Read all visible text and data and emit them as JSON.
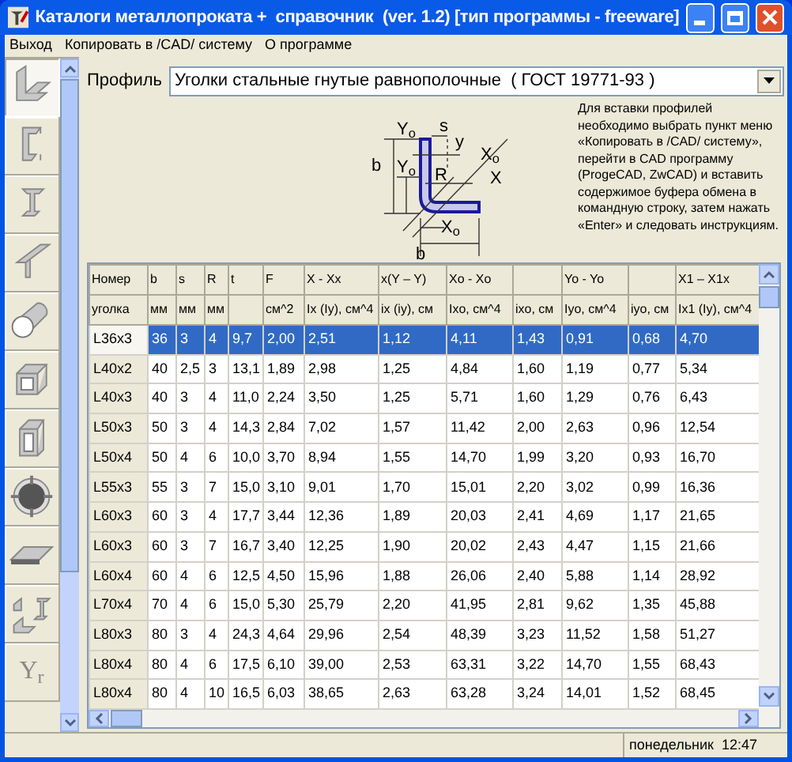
{
  "window": {
    "title": "Каталоги металлопроката +  справочник  (ver. 1.2) [тип программы - freeware]"
  },
  "menu": [
    "Выход",
    "Копировать в /CAD/ систему",
    "О программе"
  ],
  "sidebar": {
    "items": [
      {
        "selected": true
      },
      {
        "selected": false
      },
      {
        "selected": false
      },
      {
        "selected": false
      },
      {
        "selected": false
      },
      {
        "selected": false
      },
      {
        "selected": false
      },
      {
        "selected": false
      },
      {
        "selected": false
      },
      {
        "selected": false
      },
      {
        "selected": false,
        "label": "Y$_{r}$"
      }
    ]
  },
  "profile": {
    "label": "Профиль",
    "value": "Уголки стальные гнутые равнополочные  ( ГОСТ 19771-93 )"
  },
  "diagram": {
    "labels": [
      "Y$_{o}$",
      "s",
      "y",
      "X$_{o}$",
      "b",
      "Y$_{o}$",
      "R",
      "X",
      "X$_{o}$",
      "b"
    ]
  },
  "instructions": "Для вставки профилей необходимо выбрать пункт меню «Копировать в /CAD/ систему», перейти в CAD программу (ProgeCAD, ZwCAD) и вставить содержимое буфера обмена в командную строку,  затем нажать «Enter» и следовать инструкциям.",
  "table": {
    "columns": [
      {
        "top": "Номер",
        "bottom": "уголка"
      },
      {
        "top": "b",
        "bottom": "мм"
      },
      {
        "top": "s",
        "bottom": "мм"
      },
      {
        "top": "R",
        "bottom": "мм"
      },
      {
        "top": "t"
      },
      {
        "top": "F",
        "bottom": "см^2"
      },
      {
        "top": "X - Xx",
        "bottom": "Ix (Iy), см^4"
      },
      {
        "top": "x(Y – Y)",
        "bottom": "ix (iy), см"
      },
      {
        "top": "Xo - Xo",
        "bottom": "Ixo, см^4"
      },
      {
        "bottom": "ixo, см"
      },
      {
        "top": "Yo - Yo",
        "bottom": "Iyo, см^4"
      },
      {
        "bottom": "iyo, см"
      },
      {
        "top": "X1 – X1x",
        "bottom": "Ix1 (Iy), см^4"
      }
    ],
    "rows": [
      {
        "selected": true,
        "cells": [
          "L36x3",
          "36",
          "3",
          "4",
          "9,7",
          "2,00",
          "2,51",
          "1,12",
          "4,11",
          "1,43",
          "0,91",
          "0,68",
          "4,70"
        ]
      },
      {
        "selected": false,
        "cells": [
          "L40x2",
          "40",
          "2,5",
          "3",
          "13,1",
          "1,89",
          "2,98",
          "1,25",
          "4,84",
          "1,60",
          "1,19",
          "0,77",
          "5,34"
        ]
      },
      {
        "selected": false,
        "cells": [
          "L40x3",
          "40",
          "3",
          "4",
          "11,0",
          "2,24",
          "3,50",
          "1,25",
          "5,71",
          "1,60",
          "1,29",
          "0,76",
          "6,43"
        ]
      },
      {
        "selected": false,
        "cells": [
          "L50x3",
          "50",
          "3",
          "4",
          "14,3",
          "2,84",
          "7,02",
          "1,57",
          "11,42",
          "2,00",
          "2,63",
          "0,96",
          "12,54"
        ]
      },
      {
        "selected": false,
        "cells": [
          "L50x4",
          "50",
          "4",
          "6",
          "10,0",
          "3,70",
          "8,94",
          "1,55",
          "14,70",
          "1,99",
          "3,20",
          "0,93",
          "16,70"
        ]
      },
      {
        "selected": false,
        "cells": [
          "L55x3",
          "55",
          "3",
          "7",
          "15,0",
          "3,10",
          "9,01",
          "1,70",
          "15,01",
          "2,20",
          "3,02",
          "0,99",
          "16,36"
        ]
      },
      {
        "selected": false,
        "cells": [
          "L60x3",
          "60",
          "3",
          "4",
          "17,7",
          "3,44",
          "12,36",
          "1,89",
          "20,03",
          "2,41",
          "4,69",
          "1,17",
          "21,65"
        ]
      },
      {
        "selected": false,
        "cells": [
          "L60x3",
          "60",
          "3",
          "7",
          "16,7",
          "3,40",
          "12,25",
          "1,90",
          "20,02",
          "2,43",
          "4,47",
          "1,15",
          "21,66"
        ]
      },
      {
        "selected": false,
        "cells": [
          "L60x4",
          "60",
          "4",
          "6",
          "12,5",
          "4,50",
          "15,96",
          "1,88",
          "26,06",
          "2,40",
          "5,88",
          "1,14",
          "28,92"
        ]
      },
      {
        "selected": false,
        "cells": [
          "L70x4",
          "70",
          "4",
          "6",
          "15,0",
          "5,30",
          "25,79",
          "2,20",
          "41,95",
          "2,81",
          "9,62",
          "1,35",
          "45,88"
        ]
      },
      {
        "selected": false,
        "cells": [
          "L80x3",
          "80",
          "3",
          "4",
          "24,3",
          "4,64",
          "29,96",
          "2,54",
          "48,39",
          "3,23",
          "11,52",
          "1,58",
          "51,27"
        ]
      },
      {
        "selected": false,
        "cells": [
          "L80x4",
          "80",
          "4",
          "6",
          "17,5",
          "6,10",
          "39,00",
          "2,53",
          "63,31",
          "3,22",
          "14,70",
          "1,55",
          "68,43"
        ]
      },
      {
        "selected": false,
        "cells": [
          "L80x4",
          "80",
          "4",
          "10",
          "16,5",
          "6,03",
          "38,65",
          "2,63",
          "63,28",
          "3,24",
          "14,01",
          "1,52",
          "68,45"
        ]
      }
    ]
  },
  "status_bar": {
    "text": "понедельник  12:47"
  }
}
